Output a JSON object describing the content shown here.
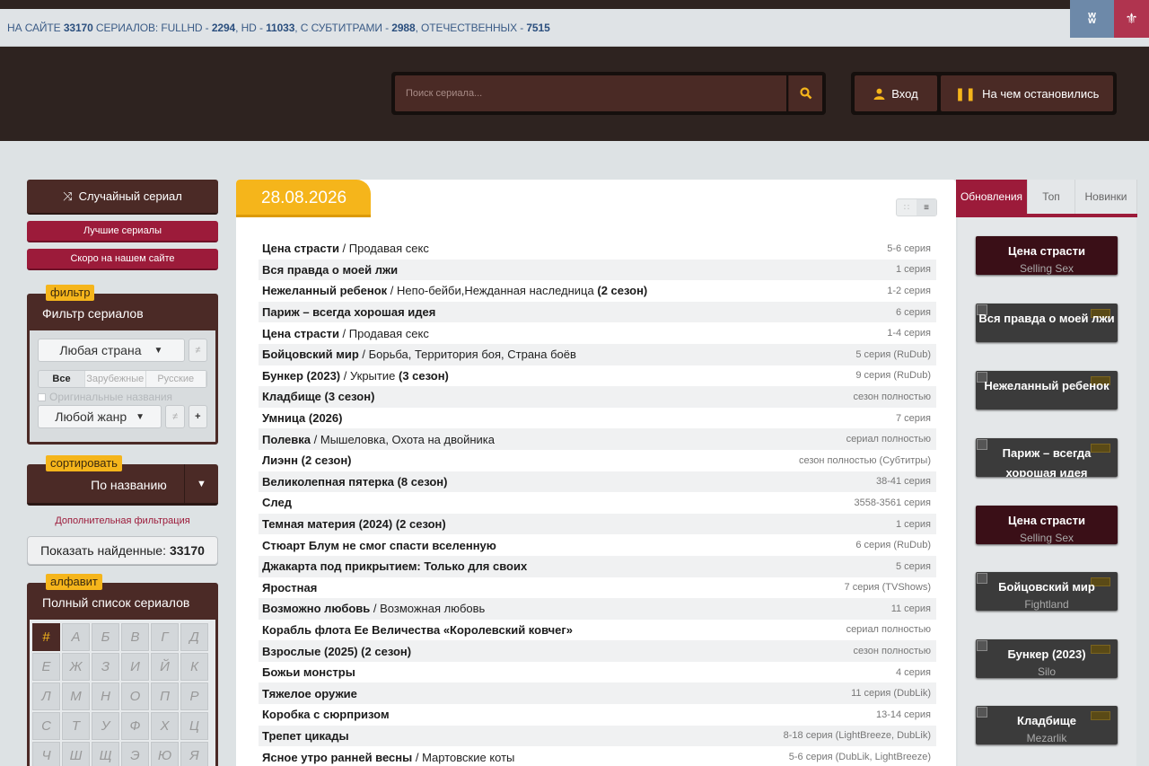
{
  "topbar": {
    "stats_prefix": "НА САЙТЕ ",
    "total": "33170",
    "stats_mid1": " СЕРИАЛОВ: FULLHD - ",
    "fullhd": "2294",
    "stats_mid2": ", HD - ",
    "hd": "11033",
    "stats_mid3": ", С СУБТИТРАМИ - ",
    "subs": "2988",
    "stats_mid4": ", ОТЕЧЕСТВЕННЫХ - ",
    "domestic": "7515",
    "vk_label": "ВК",
    "mr_icon": "odnoklassniki-icon"
  },
  "header": {
    "search_placeholder": "Поиск сериала...",
    "login_label": "Вход",
    "continue_label": "На чем остановились",
    "login_icon": "user-icon",
    "continue_icon": "pause-icon",
    "search_icon": "magnifier-icon"
  },
  "sidebar": {
    "random_label": "Случайный сериал",
    "best_label": "Лучшие сериалы",
    "soon_label": "Скоро на нашем сайте",
    "filter_tag": "фильтр",
    "filter_title": "Фильтр сериалов",
    "country_select": "Любая страна",
    "origin_all": "Все",
    "origin_foreign": "Зарубежные",
    "origin_russian": "Русские",
    "original_names": "Оригинальные названия",
    "genre_select": "Любой жанр",
    "sort_tag": "сортировать",
    "sort_value": "По названию",
    "extra_filter": "Дополнительная фильтрация",
    "show_found_label": "Показать найденные:",
    "show_found_count": "33170",
    "alpha_tag": "алфавит",
    "alpha_title": "Полный список сериалов",
    "letters": [
      "#",
      "А",
      "Б",
      "В",
      "Г",
      "Д",
      "Е",
      "Ж",
      "З",
      "И",
      "Й",
      "К",
      "Л",
      "М",
      "Н",
      "О",
      "П",
      "Р",
      "С",
      "Т",
      "У",
      "Ф",
      "Х",
      "Ц",
      "Ч",
      "Ш",
      "Щ",
      "Э",
      "Ю",
      "Я"
    ]
  },
  "main": {
    "date": "28.08.2026",
    "rows": [
      {
        "title": "Цена страсти",
        "alt": "Продавая секс",
        "season": "",
        "ep": "5-6 серия"
      },
      {
        "title": "Вся правда о моей лжи",
        "alt": "",
        "season": "",
        "ep": "1 серия"
      },
      {
        "title": "Нежеланный ребенок",
        "alt": "Непо-бейби,Нежданная наследница",
        "season": "(2 сезон)",
        "ep": "1-2 серия"
      },
      {
        "title": "Париж – всегда хорошая идея",
        "alt": "",
        "season": "",
        "ep": "6 серия"
      },
      {
        "title": "Цена страсти",
        "alt": "Продавая секс",
        "season": "",
        "ep": "1-4 серия"
      },
      {
        "title": "Бойцовский мир",
        "alt": "Борьба, Территория боя, Страна боёв",
        "season": "",
        "ep": "5 серия (RuDub)"
      },
      {
        "title": "Бункер (2023)",
        "alt": "Укрытие",
        "season": "(3 сезон)",
        "ep": "9 серия (RuDub)"
      },
      {
        "title": "Кладбище (3 сезон)",
        "alt": "",
        "season": "",
        "ep": "сезон полностью"
      },
      {
        "title": "Умница (2026)",
        "alt": "",
        "season": "",
        "ep": "7 серия"
      },
      {
        "title": "Полевка",
        "alt": "Мышеловка, Охота на двойника",
        "season": "",
        "ep": "сериал полностью"
      },
      {
        "title": "Лиэнн (2 сезон)",
        "alt": "",
        "season": "",
        "ep": "сезон полностью (Субтитры)"
      },
      {
        "title": "Великолепная пятерка (8 сезон)",
        "alt": "",
        "season": "",
        "ep": "38-41 серия"
      },
      {
        "title": "След",
        "alt": "",
        "season": "",
        "ep": "3558-3561 серия"
      },
      {
        "title": "Темная материя (2024) (2 сезон)",
        "alt": "",
        "season": "",
        "ep": "1 серия"
      },
      {
        "title": "Стюарт Блум не смог спасти вселенную",
        "alt": "",
        "season": "",
        "ep": "6 серия (RuDub)"
      },
      {
        "title": "Джакарта под прикрытием: Только для своих",
        "alt": "",
        "season": "",
        "ep": "5 серия"
      },
      {
        "title": "Яростная",
        "alt": "",
        "season": "",
        "ep": "7 серия (TVShows)"
      },
      {
        "title": "Возможно любовь",
        "alt": "Возможная любовь",
        "season": "",
        "ep": "11 серия"
      },
      {
        "title": "Корабль флота Ее Величества «Королевский ковчег»",
        "alt": "",
        "season": "",
        "ep": "сериал полностью"
      },
      {
        "title": "Взрослые (2025) (2 сезон)",
        "alt": "",
        "season": "",
        "ep": "сезон полностью"
      },
      {
        "title": "Божьи монстры",
        "alt": "",
        "season": "",
        "ep": "4 серия"
      },
      {
        "title": "Тяжелое оружие",
        "alt": "",
        "season": "",
        "ep": "11 серия (DubLik)"
      },
      {
        "title": "Коробка с сюрпризом",
        "alt": "",
        "season": "",
        "ep": "13-14 серия"
      },
      {
        "title": "Трепет цикады",
        "alt": "",
        "season": "",
        "ep": "8-18 серия (LightBreeze, DubLik)"
      },
      {
        "title": "Ясное утро ранней весны",
        "alt": "Мартовские коты",
        "season": "",
        "ep": "5-6 серия (DubLik, LightBreeze)"
      }
    ]
  },
  "right": {
    "tabs": [
      "Обновления",
      "Топ",
      "Новинки"
    ],
    "cards": [
      {
        "title": "Цена страсти",
        "sub": "Selling Sex",
        "dark": true
      },
      {
        "title": "Вся правда о моей лжи",
        "sub": "",
        "dark": false
      },
      {
        "title": "Нежеланный ребенок",
        "sub": "",
        "dark": false
      },
      {
        "title": "Париж – всегда хорошая идея",
        "sub": "",
        "dark": false
      },
      {
        "title": "Цена страсти",
        "sub": "Selling Sex",
        "dark": true
      },
      {
        "title": "Бойцовский мир",
        "sub": "Fightland",
        "dark": false
      },
      {
        "title": "Бункер (2023)",
        "sub": "Silo",
        "dark": false
      },
      {
        "title": "Кладбище",
        "sub": "Mezarlik",
        "dark": false
      }
    ]
  }
}
